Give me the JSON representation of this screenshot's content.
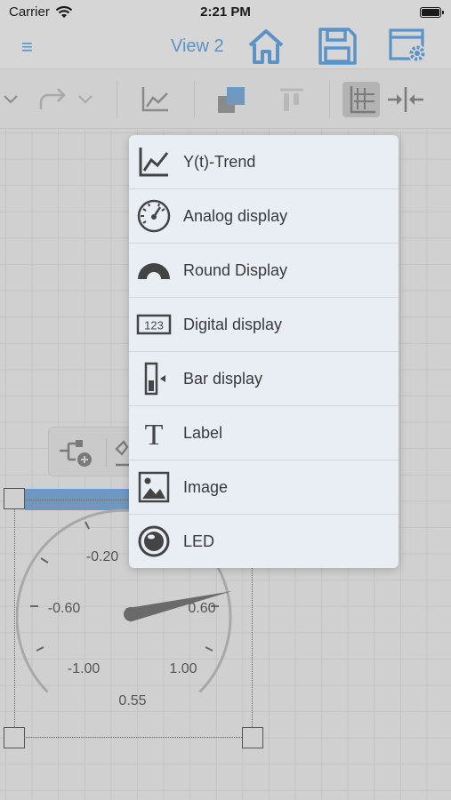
{
  "status": {
    "carrier": "Carrier",
    "time": "2:21 PM"
  },
  "nav": {
    "title": "View 2",
    "menu_icon": "menu-icon",
    "home_icon": "home-icon",
    "save_icon": "save-icon",
    "settings_icon": "window-settings-icon"
  },
  "toolbar": {
    "icons": [
      "chevron-down-icon",
      "redo-icon",
      "chevron-down-icon",
      "trend-chart-icon",
      "bring-front-icon",
      "align-top-icon",
      "grid-icon",
      "fit-horizontal-icon"
    ],
    "active": "grid-icon"
  },
  "menu": {
    "items": [
      {
        "label": "Y(t)-Trend",
        "icon": "trend-chart-icon"
      },
      {
        "label": "Analog display",
        "icon": "analog-gauge-icon"
      },
      {
        "label": "Round Display",
        "icon": "round-gauge-icon"
      },
      {
        "label": "Digital display",
        "icon": "digital-display-icon"
      },
      {
        "label": "Bar display",
        "icon": "bar-display-icon"
      },
      {
        "label": "Label",
        "icon": "text-label-icon"
      },
      {
        "label": "Image",
        "icon": "image-icon"
      },
      {
        "label": "LED",
        "icon": "led-icon"
      }
    ]
  },
  "gauge": {
    "tick_labels": [
      "-0.20",
      "-0.60",
      "0.60",
      "-1.00",
      "1.00"
    ],
    "value": "0.55"
  },
  "colors": {
    "accent": "#5b93c7",
    "widget_bar": "#6f98c0"
  }
}
